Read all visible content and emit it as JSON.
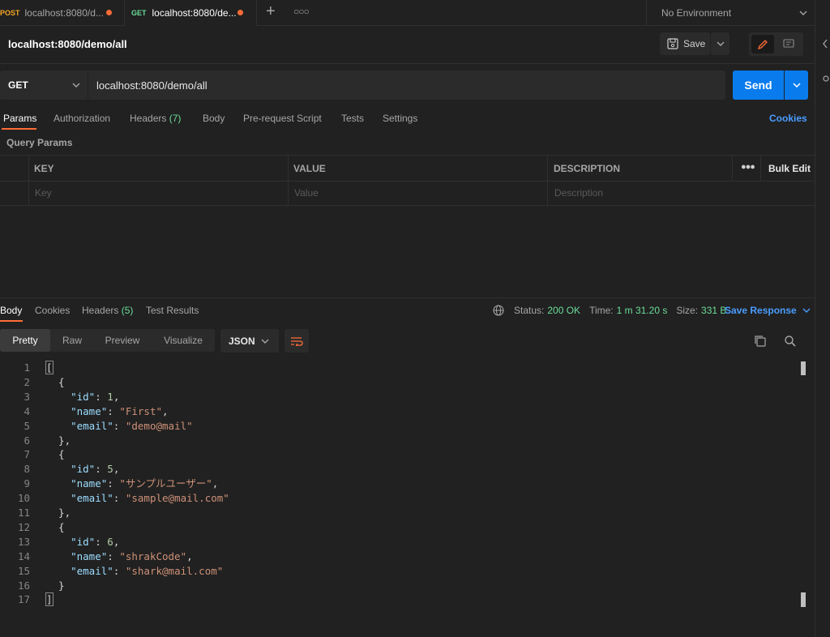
{
  "tabs": [
    {
      "method": "POST",
      "title": "localhost:8080/d..."
    },
    {
      "method": "GET",
      "title": "localhost:8080/de..."
    }
  ],
  "environment": "No Environment",
  "request": {
    "title": "localhost:8080/demo/all",
    "save_label": "Save",
    "method": "GET",
    "url": "localhost:8080/demo/all",
    "send_label": "Send"
  },
  "request_tabs": {
    "params": "Params",
    "authorization": "Authorization",
    "headers": "Headers",
    "headers_count": "(7)",
    "body": "Body",
    "prerequest": "Pre-request Script",
    "tests": "Tests",
    "settings": "Settings",
    "cookies": "Cookies"
  },
  "query_params": {
    "label": "Query Params",
    "columns": [
      "KEY",
      "VALUE",
      "DESCRIPTION"
    ],
    "bulk_edit": "Bulk Edit",
    "placeholders": [
      "Key",
      "Value",
      "Description"
    ]
  },
  "response": {
    "tabs": {
      "body": "Body",
      "cookies": "Cookies",
      "headers": "Headers",
      "headers_count": "(5)",
      "test_results": "Test Results"
    },
    "status_label": "Status:",
    "status_value": "200 OK",
    "time_label": "Time:",
    "time_value": "1 m 31.20 s",
    "size_label": "Size:",
    "size_value": "331 B",
    "save_response": "Save Response",
    "views": [
      "Pretty",
      "Raw",
      "Preview",
      "Visualize"
    ],
    "format": "JSON"
  },
  "code_lines": [
    [
      [
        "p",
        "["
      ]
    ],
    [
      [
        "p",
        "  {"
      ]
    ],
    [
      [
        "p",
        "    "
      ],
      [
        "k",
        "\"id\""
      ],
      [
        "p",
        ": "
      ],
      [
        "n",
        "1"
      ],
      [
        "p",
        ","
      ]
    ],
    [
      [
        "p",
        "    "
      ],
      [
        "k",
        "\"name\""
      ],
      [
        "p",
        ": "
      ],
      [
        "s",
        "\"First\""
      ],
      [
        "p",
        ","
      ]
    ],
    [
      [
        "p",
        "    "
      ],
      [
        "k",
        "\"email\""
      ],
      [
        "p",
        ": "
      ],
      [
        "s",
        "\"demo@mail\""
      ]
    ],
    [
      [
        "p",
        "  },"
      ]
    ],
    [
      [
        "p",
        "  {"
      ]
    ],
    [
      [
        "p",
        "    "
      ],
      [
        "k",
        "\"id\""
      ],
      [
        "p",
        ": "
      ],
      [
        "n",
        "5"
      ],
      [
        "p",
        ","
      ]
    ],
    [
      [
        "p",
        "    "
      ],
      [
        "k",
        "\"name\""
      ],
      [
        "p",
        ": "
      ],
      [
        "s",
        "\"サンプルユーザー\""
      ],
      [
        "p",
        ","
      ]
    ],
    [
      [
        "p",
        "    "
      ],
      [
        "k",
        "\"email\""
      ],
      [
        "p",
        ": "
      ],
      [
        "s",
        "\"sample@mail.com\""
      ]
    ],
    [
      [
        "p",
        "  },"
      ]
    ],
    [
      [
        "p",
        "  {"
      ]
    ],
    [
      [
        "p",
        "    "
      ],
      [
        "k",
        "\"id\""
      ],
      [
        "p",
        ": "
      ],
      [
        "n",
        "6"
      ],
      [
        "p",
        ","
      ]
    ],
    [
      [
        "p",
        "    "
      ],
      [
        "k",
        "\"name\""
      ],
      [
        "p",
        ": "
      ],
      [
        "s",
        "\"shrakCode\""
      ],
      [
        "p",
        ","
      ]
    ],
    [
      [
        "p",
        "    "
      ],
      [
        "k",
        "\"email\""
      ],
      [
        "p",
        ": "
      ],
      [
        "s",
        "\"shark@mail.com\""
      ]
    ],
    [
      [
        "p",
        "  }"
      ]
    ],
    [
      [
        "p",
        "]"
      ]
    ]
  ]
}
